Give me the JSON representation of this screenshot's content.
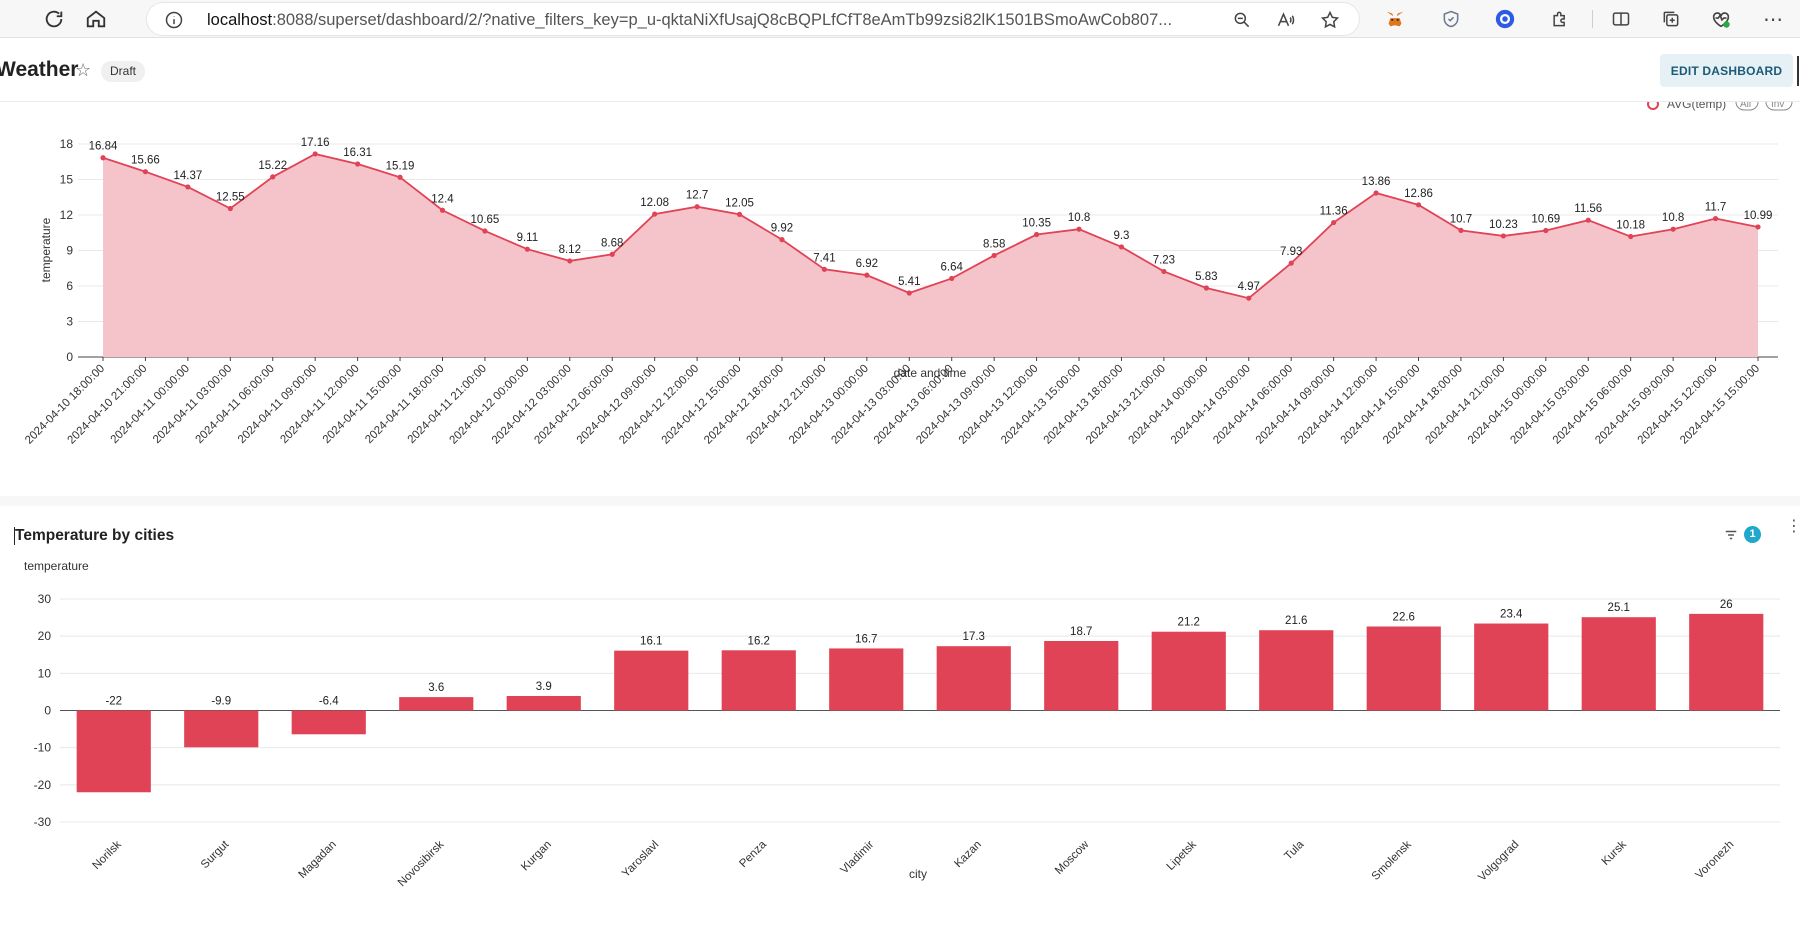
{
  "browser": {
    "url_host": "localhost",
    "url_rest": ":8088/superset/dashboard/2/?native_filters_key=p_u-qktaNiXfUsajQ8cBQPLfCfT8eAmTb99zsi82lK1501BSmoAwCob807..."
  },
  "dashboard": {
    "title": "Weather",
    "status_badge": "Draft",
    "edit_label": "EDIT DASHBOARD"
  },
  "line_chart_panel": {
    "legend_label": "AVG(temp)",
    "legend_btn_all": "All",
    "legend_btn_inv": "Inv"
  },
  "bar_chart_panel": {
    "title": "Temperature by cities",
    "filter_count": "1"
  },
  "colors": {
    "series": "#e04355",
    "area": "#f5c4cb",
    "accent": "#20a7c9"
  },
  "chart_data": [
    {
      "type": "area",
      "xlabel": "date and time",
      "ylabel": "temperature",
      "ylim": [
        0,
        18
      ],
      "yticks": [
        0,
        3,
        6,
        9,
        12,
        15,
        18
      ],
      "grid": true,
      "series": [
        {
          "name": "AVG(temp)"
        }
      ],
      "x": [
        "2024-04-10 18:00:00",
        "2024-04-10 21:00:00",
        "2024-04-11 00:00:00",
        "2024-04-11 03:00:00",
        "2024-04-11 06:00:00",
        "2024-04-11 09:00:00",
        "2024-04-11 12:00:00",
        "2024-04-11 15:00:00",
        "2024-04-11 18:00:00",
        "2024-04-11 21:00:00",
        "2024-04-12 00:00:00",
        "2024-04-12 03:00:00",
        "2024-04-12 06:00:00",
        "2024-04-12 09:00:00",
        "2024-04-12 12:00:00",
        "2024-04-12 15:00:00",
        "2024-04-12 18:00:00",
        "2024-04-12 21:00:00",
        "2024-04-13 00:00:00",
        "2024-04-13 03:00:00",
        "2024-04-13 06:00:00",
        "2024-04-13 09:00:00",
        "2024-04-13 12:00:00",
        "2024-04-13 15:00:00",
        "2024-04-13 18:00:00",
        "2024-04-13 21:00:00",
        "2024-04-14 00:00:00",
        "2024-04-14 03:00:00",
        "2024-04-14 06:00:00",
        "2024-04-14 09:00:00",
        "2024-04-14 12:00:00",
        "2024-04-14 15:00:00",
        "2024-04-14 18:00:00",
        "2024-04-14 21:00:00",
        "2024-04-15 00:00:00",
        "2024-04-15 03:00:00",
        "2024-04-15 06:00:00",
        "2024-04-15 09:00:00",
        "2024-04-15 12:00:00",
        "2024-04-15 15:00:00"
      ],
      "y": [
        16.84,
        15.66,
        14.37,
        12.55,
        15.22,
        17.16,
        16.31,
        15.19,
        12.4,
        10.65,
        9.11,
        8.12,
        8.68,
        12.08,
        12.7,
        12.05,
        9.92,
        7.41,
        6.92,
        5.41,
        6.64,
        8.58,
        10.35,
        10.8,
        9.3,
        7.23,
        5.83,
        4.97,
        7.93,
        11.36,
        13.86,
        12.86,
        10.7,
        10.23,
        10.69,
        11.56,
        10.18,
        10.8,
        11.7,
        10.99
      ]
    },
    {
      "type": "bar",
      "title": "Temperature by cities",
      "xlabel": "city",
      "ylabel": "temperature",
      "ylim": [
        -30,
        30
      ],
      "yticks": [
        -30,
        -20,
        -10,
        0,
        10,
        20,
        30
      ],
      "grid": true,
      "categories": [
        "Norilsk",
        "Surgut",
        "Magadan",
        "Novosibirsk",
        "Kurgan",
        "Yaroslavl",
        "Penza",
        "Vladimir",
        "Kazan",
        "Moscow",
        "Lipetsk",
        "Tula",
        "Smolensk",
        "Volgograd",
        "Kursk",
        "Voronezh"
      ],
      "values": [
        -22,
        -9.9,
        -6.4,
        3.6,
        3.9,
        16.1,
        16.2,
        16.7,
        17.3,
        18.7,
        21.2,
        21.6,
        22.6,
        23.4,
        25.1,
        26
      ]
    }
  ]
}
